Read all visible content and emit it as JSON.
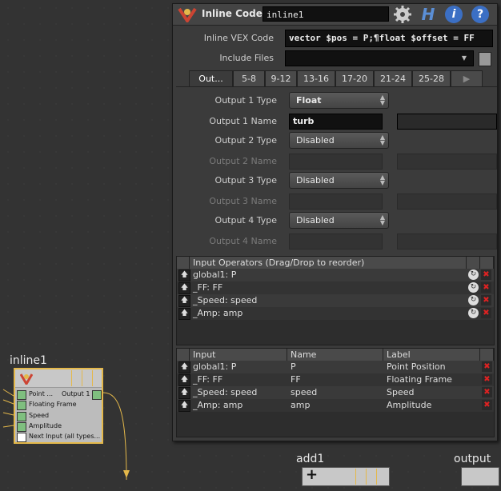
{
  "header": {
    "title": "Inline Code",
    "node_name": "inline1"
  },
  "parms": {
    "vex_label": "Inline VEX Code",
    "vex_value": "vector $pos = P;¶float $offset = FF",
    "include_label": "Include Files",
    "include_value": ""
  },
  "tabs": [
    "Out...",
    "5-8",
    "9-12",
    "13-16",
    "17-20",
    "21-24",
    "25-28"
  ],
  "outputs": [
    {
      "type_label": "Output 1 Type",
      "type_value": "Float",
      "name_label": "Output 1 Name",
      "name_value": "turb"
    },
    {
      "type_label": "Output 2 Type",
      "type_value": "Disabled",
      "name_label": "Output 2 Name",
      "name_value": ""
    },
    {
      "type_label": "Output 3 Type",
      "type_value": "Disabled",
      "name_label": "Output 3 Name",
      "name_value": ""
    },
    {
      "type_label": "Output 4 Type",
      "type_value": "Disabled",
      "name_label": "Output 4 Name",
      "name_value": ""
    }
  ],
  "input_ops": {
    "header": "Input Operators (Drag/Drop to reorder)",
    "rows": [
      "global1: P",
      "_FF: FF",
      "_Speed: speed",
      "_Amp: amp"
    ]
  },
  "inputs_table": {
    "columns": [
      "Input",
      "Name",
      "Label"
    ],
    "rows": [
      [
        "global1: P",
        "P",
        "Point Position"
      ],
      [
        "_FF: FF",
        "FF",
        "Floating Frame"
      ],
      [
        "_Speed: speed",
        "speed",
        "Speed"
      ],
      [
        "_Amp: amp",
        "amp",
        "Amplitude"
      ]
    ]
  },
  "network": {
    "inline_node": {
      "name": "inline1",
      "inputs": [
        "Point ...",
        "Floating Frame",
        "Speed",
        "Amplitude",
        "Next Input (all types..."
      ],
      "output": "Output 1"
    },
    "add_node": {
      "name": "add1",
      "symbol": "+"
    },
    "output_node": {
      "name": "output"
    }
  },
  "icon_names": [
    "vex-logo-icon",
    "gear-icon",
    "help-h-icon",
    "info-icon",
    "help-question-icon",
    "file-browse-icon"
  ]
}
